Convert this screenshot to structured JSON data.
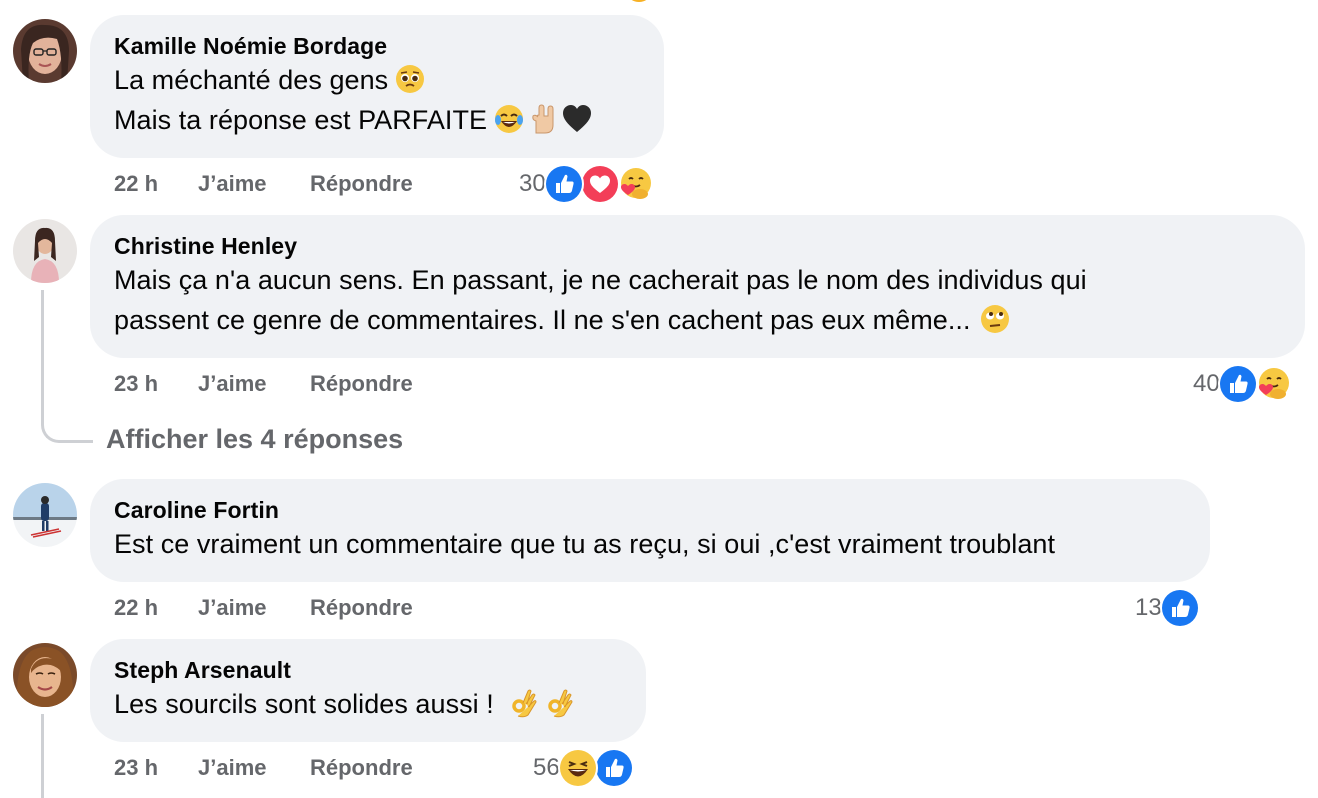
{
  "comments": [
    {
      "author": "Kamille Noémie Bordage",
      "lines": [
        "La méchanté des gens",
        "Mais ta réponse est PARFAITE"
      ],
      "line_emojis": [
        [
          "pleading-face"
        ],
        [
          "tears-of-joy-face",
          "rock-on-hand",
          "black-heart"
        ]
      ],
      "time": "22 h",
      "like_label": "J’aime",
      "reply_label": "Répondre",
      "reaction_count": "30",
      "reactions": [
        "like",
        "love",
        "care"
      ]
    },
    {
      "author": "Christine Henley",
      "lines": [
        "Mais ça n'a aucun sens. En passant, je ne cacherait pas le nom des individus qui",
        "passent ce genre de commentaires. Il ne s'en cachent pas eux même..."
      ],
      "line_emojis": [
        [],
        [
          "eye-roll-face"
        ]
      ],
      "time": "23 h",
      "like_label": "J’aime",
      "reply_label": "Répondre",
      "reaction_count": "40",
      "reactions": [
        "like",
        "care"
      ],
      "view_replies": "Afficher les 4 réponses"
    },
    {
      "author": "Caroline Fortin",
      "lines": [
        "Est ce vraiment un commentaire que tu as reçu, si oui ,c'est vraiment troublant"
      ],
      "line_emojis": [
        []
      ],
      "time": "22 h",
      "like_label": "J’aime",
      "reply_label": "Répondre",
      "reaction_count": "13",
      "reactions": [
        "like"
      ]
    },
    {
      "author": "Steph Arsenault",
      "lines": [
        "Les sourcils sont solides aussi !"
      ],
      "line_emojis": [
        [
          "ok-hand",
          "ok-hand"
        ]
      ],
      "time": "23 h",
      "like_label": "J’aime",
      "reply_label": "Répondre",
      "reaction_count": "56",
      "reactions": [
        "haha",
        "like"
      ]
    }
  ],
  "colors": {
    "bubble": "#f0f2f5",
    "meta_text": "#65676b",
    "like_blue": "#1877f2",
    "love_red": "#f33e58",
    "emoji_yellow": "#f7b125"
  }
}
